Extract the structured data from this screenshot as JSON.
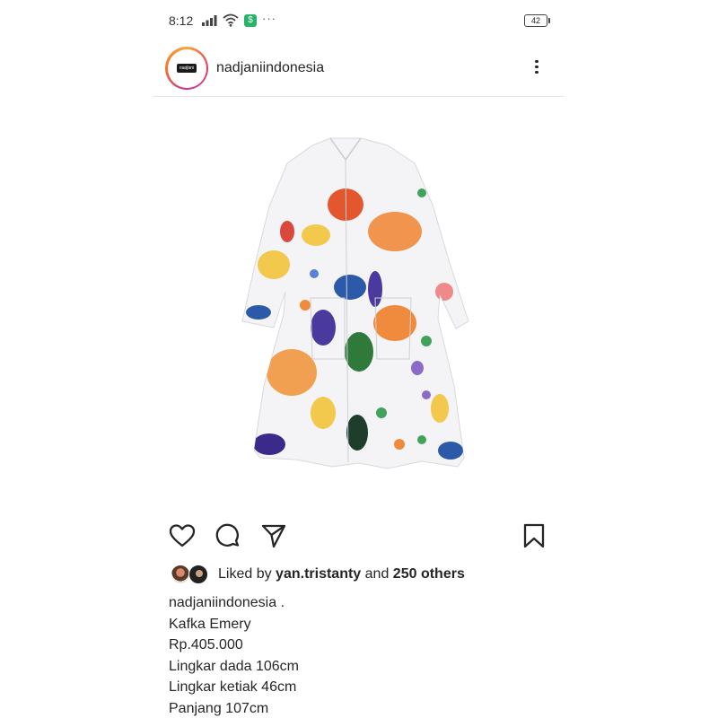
{
  "status_bar": {
    "time": "8:12",
    "extra": "···",
    "battery": "42"
  },
  "post": {
    "username": "nadjaniindonesia",
    "avatar_logo_text": "nadjani",
    "image_description_icon": "printed-shirt-dress-image",
    "liked_prefix": "Liked by",
    "liked_user": "yan.tristanty",
    "liked_and": "and",
    "liked_others": "250 others",
    "caption_user": "nadjaniindonesia",
    "caption_first": ".",
    "caption_lines": [
      "Kafka Emery",
      "Rp.405.000",
      "Lingkar dada 106cm",
      "Lingkar ketiak 46cm",
      "Panjang 107cm"
    ]
  },
  "icons": {
    "like": "heart-icon",
    "comment": "comment-icon",
    "share": "send-icon",
    "save": "bookmark-icon",
    "more": "more-vertical-icon"
  },
  "colors": {
    "text": "#262626",
    "ring_start": "#f9a43a",
    "ring_end": "#c2368f",
    "app_icon": "#28b36b"
  }
}
